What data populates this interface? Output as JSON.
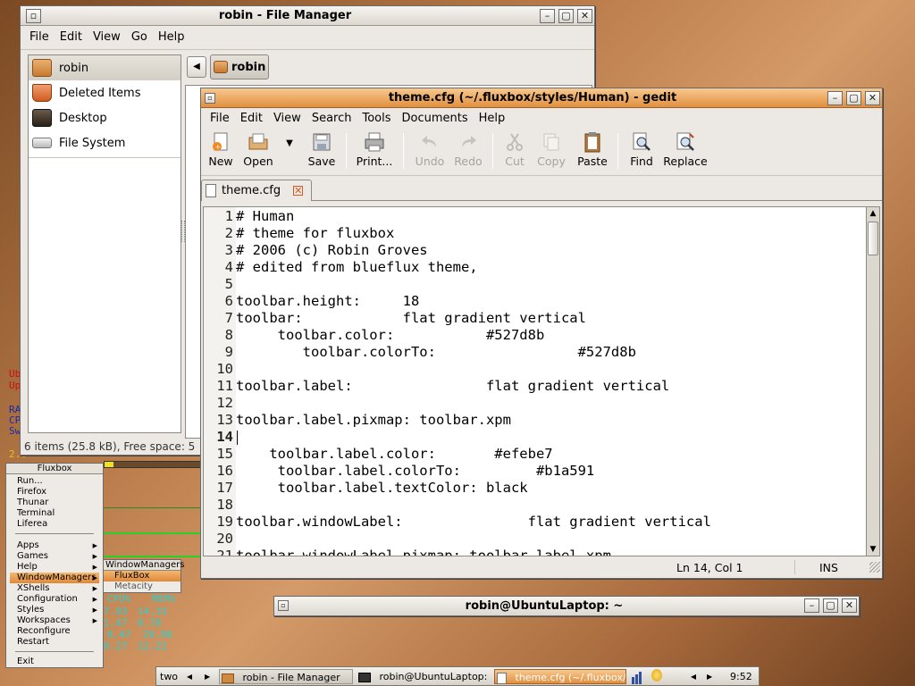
{
  "desktop": {
    "conky_lines": [
      "Ub",
      "Up",
      "RA",
      "CP",
      "Sw",
      "2.6"
    ],
    "wm_submenu": {
      "header": "WindowManagers",
      "items": [
        "FluxBox",
        "Metacity"
      ]
    },
    "cpu_table": {
      "headers": [
        "CPU%",
        "MEM%"
      ],
      "rows": [
        [
          "7.93",
          "14.33"
        ],
        [
          "1.47",
          "0.78"
        ],
        [
          "0.47",
          "29.96"
        ],
        [
          "0.27",
          "12.22"
        ]
      ]
    }
  },
  "file_manager": {
    "title": "robin - File Manager",
    "menu": [
      "File",
      "Edit",
      "View",
      "Go",
      "Help"
    ],
    "sidebar": [
      {
        "label": "robin",
        "icon": "home-folder-icon"
      },
      {
        "label": "Deleted Items",
        "icon": "trash-icon"
      },
      {
        "label": "Desktop",
        "icon": "desktop-icon"
      },
      {
        "label": "File System",
        "icon": "drive-icon"
      }
    ],
    "path_button": "robin",
    "status": "6 items (25.8 kB), Free space: 5"
  },
  "gedit": {
    "title": "theme.cfg (~/.fluxbox/styles/Human) - gedit",
    "menu": [
      "File",
      "Edit",
      "View",
      "Search",
      "Tools",
      "Documents",
      "Help"
    ],
    "toolbar": {
      "new": "New",
      "open": "Open",
      "save": "Save",
      "print": "Print...",
      "undo": "Undo",
      "redo": "Redo",
      "cut": "Cut",
      "copy": "Copy",
      "paste": "Paste",
      "find": "Find",
      "replace": "Replace"
    },
    "tab_label": "theme.cfg",
    "lines": [
      {
        "n": "1",
        "text": "# Human"
      },
      {
        "n": "2",
        "text": "# theme for fluxbox"
      },
      {
        "n": "3",
        "text": "# 2006 (c) Robin Groves"
      },
      {
        "n": "4",
        "text": "# edited from blueflux theme,"
      },
      {
        "n": "5",
        "text": ""
      },
      {
        "n": "6",
        "text": "toolbar.height:     18"
      },
      {
        "n": "7",
        "text": "toolbar:            flat gradient vertical"
      },
      {
        "n": "8",
        "text": "     toolbar.color:           #527d8b"
      },
      {
        "n": "9",
        "text": "        toolbar.colorTo:                 #527d8b"
      },
      {
        "n": "10",
        "text": ""
      },
      {
        "n": "11",
        "text": "toolbar.label:                flat gradient vertical"
      },
      {
        "n": "12",
        "text": ""
      },
      {
        "n": "13",
        "text": "toolbar.label.pixmap: toolbar.xpm"
      },
      {
        "n": "14",
        "text": ""
      },
      {
        "n": "15",
        "text": "    toolbar.label.color:       #efebe7"
      },
      {
        "n": "16",
        "text": "     toolbar.label.colorTo:         #b1a591"
      },
      {
        "n": "17",
        "text": "     toolbar.label.textColor: black"
      },
      {
        "n": "18",
        "text": ""
      },
      {
        "n": "19",
        "text": "toolbar.windowLabel:               flat gradient vertical"
      },
      {
        "n": "20",
        "text": ""
      },
      {
        "n": "21",
        "text": "toolbar.windowLabel.pixmap: toolbar.label.xpm"
      }
    ],
    "status_position": "Ln 14, Col 1",
    "status_mode": "INS"
  },
  "terminal": {
    "title": "robin@UbuntuLaptop: ~"
  },
  "fluxbox_menu": {
    "title": "Fluxbox",
    "group1": [
      "Run...",
      "Firefox",
      "Thunar",
      "Terminal",
      "Liferea"
    ],
    "group2": [
      "Apps",
      "Games",
      "Help",
      "WindowManagers",
      "XShells",
      "Configuration",
      "Styles",
      "Workspaces",
      "Reconfigure",
      "Restart"
    ],
    "exit": "Exit"
  },
  "taskbar": {
    "workspace": "two",
    "tasks": [
      "robin - File Manager",
      "robin@UbuntuLaptop: ~",
      "theme.cfg (~/.fluxbox/st"
    ],
    "clock": "9:52"
  },
  "colors": {
    "accent_orange": "#e08838",
    "selection": "#d4cfc5"
  }
}
